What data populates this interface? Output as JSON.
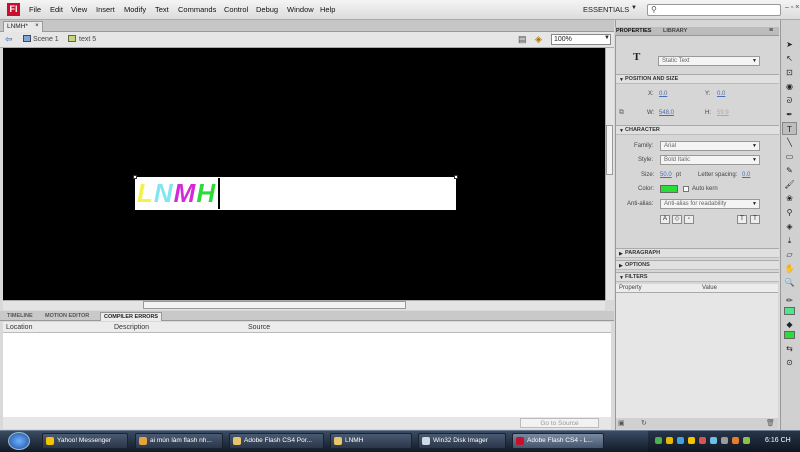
{
  "app": {
    "logo": "Fl"
  },
  "menubar": {
    "items": [
      "File",
      "Edit",
      "View",
      "Insert",
      "Modify",
      "Text",
      "Commands",
      "Control",
      "Debug",
      "Window",
      "Help"
    ],
    "workspace": "ESSENTIALS",
    "search_placeholder": ""
  },
  "document": {
    "tab": "LNMH*",
    "close": "×"
  },
  "editbar": {
    "scene": "Scene 1",
    "symbol": "text 5",
    "zoom": "100%"
  },
  "stage": {
    "background": "#000000",
    "text_chars": [
      {
        "ch": "L",
        "color": "#f2f24a"
      },
      {
        "ch": "N",
        "color": "#7fe6f2"
      },
      {
        "ch": "M",
        "color": "#d22ad6"
      },
      {
        "ch": "H",
        "color": "#2bdc38"
      }
    ]
  },
  "bottom_panel": {
    "tabs": [
      "TIMELINE",
      "MOTION EDITOR",
      "COMPILER ERRORS"
    ],
    "active_tab": "COMPILER ERRORS",
    "columns": [
      "Location",
      "Description",
      "Source"
    ],
    "go_to_source": "Go to Source"
  },
  "properties": {
    "tabs": [
      "PROPERTIES",
      "LIBRARY"
    ],
    "text_type": "Static Text",
    "position_size": {
      "header": "POSITION AND SIZE",
      "x_label": "X:",
      "x": "0.0",
      "y_label": "Y:",
      "y": "0.0",
      "w_label": "W:",
      "w": "548.0",
      "h_label": "H:",
      "h": "59.9"
    },
    "character": {
      "header": "CHARACTER",
      "family_label": "Family:",
      "family": "Arial",
      "style_label": "Style:",
      "style": "Bold Italic",
      "size_label": "Size:",
      "size": "50.0",
      "size_unit": "pt",
      "spacing_label": "Letter spacing:",
      "spacing": "0.0",
      "color_label": "Color:",
      "color": "#2bdc38",
      "autokern": "Auto kern",
      "antialias_label": "Anti-alias:",
      "antialias": "Anti-alias for readability"
    },
    "collapsed_sections": [
      "PARAGRAPH",
      "OPTIONS",
      "FILTERS"
    ],
    "filters_columns": [
      "Property",
      "Value"
    ]
  },
  "tools": {
    "stroke_color": "#4de68c",
    "fill_color": "#2bdc38"
  },
  "taskbar": {
    "items": [
      {
        "label": "Yahoo! Messenger",
        "icon_color": "#f5c400"
      },
      {
        "label": "ai mún làm flash nh...",
        "icon_color": "#e6a23c"
      },
      {
        "label": "Adobe Flash CS4 Por...",
        "icon_color": "#e8c56a"
      },
      {
        "label": "LNMH",
        "icon_color": "#e8c56a"
      },
      {
        "label": "Win32 Disk Imager",
        "icon_color": "#cfd8e6"
      },
      {
        "label": "Adobe Flash CS4 - L...",
        "icon_color": "#c8102e"
      }
    ],
    "clock": "6:16 CH"
  }
}
